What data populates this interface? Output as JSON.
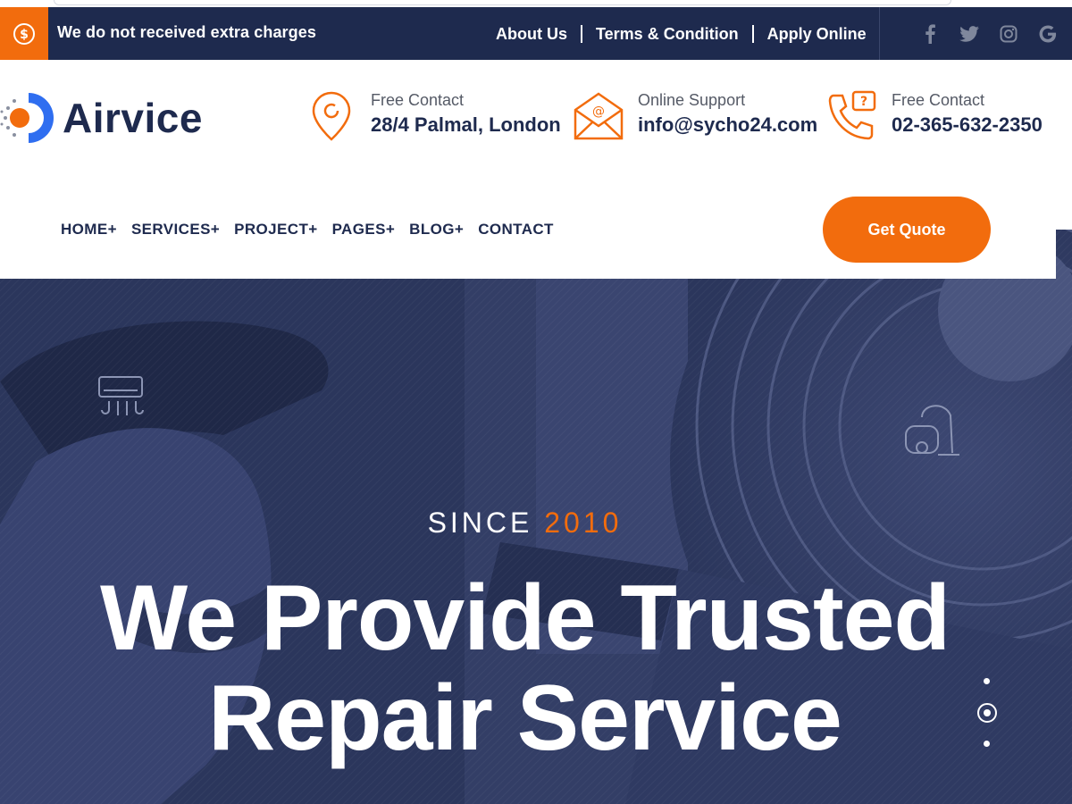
{
  "topbar": {
    "notice": "We do not received extra charges",
    "links": [
      "About Us",
      "Terms & Condition",
      "Apply Online"
    ],
    "socials": [
      "facebook-icon",
      "twitter-icon",
      "instagram-icon",
      "google-icon"
    ]
  },
  "brand": {
    "name": "Airvice"
  },
  "contacts": [
    {
      "label": "Free Contact",
      "value": "28/4 Palmal, London",
      "icon": "location-pin-icon"
    },
    {
      "label": "Online Support",
      "value": "info@sycho24.com",
      "icon": "email-icon"
    },
    {
      "label": "Free Contact",
      "value": "02-365-632-2350",
      "icon": "phone-icon"
    }
  ],
  "nav": {
    "items": [
      "HOME+",
      "SERVICES+",
      "PROJECT+",
      "PAGES+",
      "BLOG+",
      "CONTACT"
    ],
    "cta": "Get Quote"
  },
  "hero": {
    "since_label": "SINCE",
    "since_year": "2010",
    "headline_line1": "We Provide Trusted",
    "headline_line2": "Repair Service"
  },
  "colors": {
    "accent": "#f26c0d",
    "navy": "#1e2a4e",
    "hero_overlay": "#2b365c"
  }
}
